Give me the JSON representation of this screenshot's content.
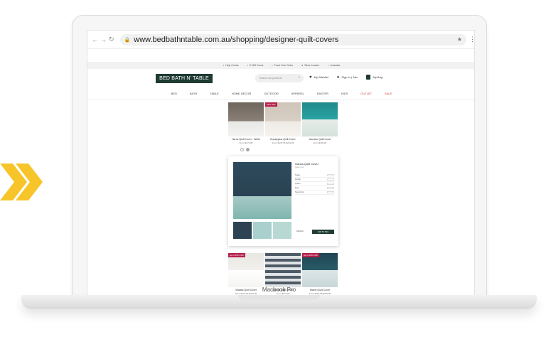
{
  "browser": {
    "url": "www.bedbathntable.com.au/shopping/designer-quilt-covers",
    "nav_icons": [
      "back-icon",
      "forward-icon",
      "reload-icon"
    ],
    "star_icon": "★",
    "menu_icon": "⋮"
  },
  "utility_bar": {
    "items": [
      "Help Centre",
      "E-Gift Cards",
      "Track Your Order",
      "Store Locator",
      "Australia"
    ]
  },
  "site": {
    "logo": "BED BATH N' TABLE",
    "search_placeholder": "Search our products",
    "my_wishlist": "My Wishlist",
    "sign_in": "Sign In | Join",
    "my_bag": "My Bag",
    "accent_color": "#1f3b33"
  },
  "categories": [
    "BED",
    "BATH",
    "TABLE",
    "HOME DECOR",
    "OUTDOOR",
    "APPAREL",
    "EASTER",
    "KIDS",
    "OUTLET",
    "SALE"
  ],
  "products_top": [
    {
      "name": "Harris Quilt Cover - White",
      "price": "From $179.95",
      "badge": ""
    },
    {
      "name": "Eucalyptus Quilt Cover",
      "price": "From $179.95 $239.95",
      "badge": "25% OFF"
    },
    {
      "name": "Jasmine Quilt Cover",
      "price": "From $169.95",
      "badge": ""
    }
  ],
  "quick_view": {
    "title": "Garcia Quilt Cover",
    "subtitle": "Select size",
    "rows": [
      "Single",
      "Double",
      "Queen",
      "King",
      "Super King"
    ],
    "add_to_bag": "ADD TO BAG",
    "wishlist": "Wishlist"
  },
  "products_bottom": [
    {
      "name": "Vitalato Quilt Cover",
      "price": "From $179.95 $239.95",
      "badge": "up to 25% OFF"
    },
    {
      "name": "Ixmont Quilt Cover",
      "price": "From $179.95",
      "badge": ""
    },
    {
      "name": "Maine Quilt Cover",
      "price": "From $169.95 $239.95",
      "badge": "up to 40% OFF"
    }
  ],
  "laptop": {
    "label": "Macbook Pro"
  }
}
